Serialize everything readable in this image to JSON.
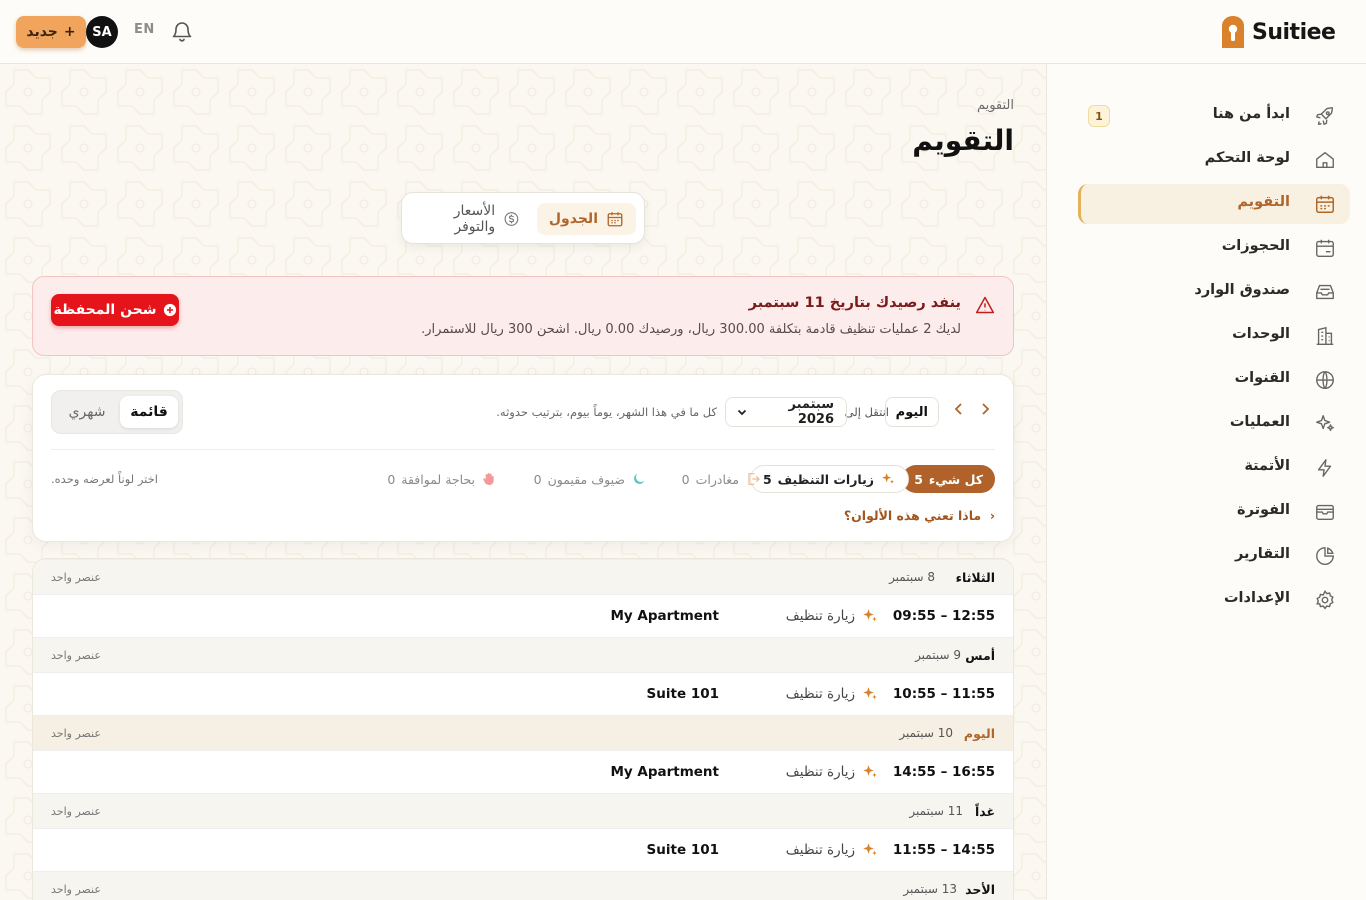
{
  "topbar": {
    "new_label": "جديد",
    "avatar_initials": "SA",
    "lang": "EN",
    "brand": "Suitiee",
    "brand_color": "#d9822b"
  },
  "sidebar": {
    "items": [
      {
        "label": "ابدأ من هنا",
        "icon": "rocket-icon",
        "badge": "1"
      },
      {
        "label": "لوحة التحكم",
        "icon": "home-icon"
      },
      {
        "label": "التقويم",
        "icon": "calendar-icon",
        "active": true
      },
      {
        "label": "الحجوزات",
        "icon": "calendar-booking-icon"
      },
      {
        "label": "صندوق الوارد",
        "icon": "inbox-icon"
      },
      {
        "label": "الوحدات",
        "icon": "building-icon"
      },
      {
        "label": "القنوات",
        "icon": "globe-icon"
      },
      {
        "label": "العمليات",
        "icon": "sparkles-icon"
      },
      {
        "label": "الأتمتة",
        "icon": "lightning-icon"
      },
      {
        "label": "الفوترة",
        "icon": "wallet-icon"
      },
      {
        "label": "التقارير",
        "icon": "pie-chart-icon"
      },
      {
        "label": "الإعدادات",
        "icon": "gear-icon"
      }
    ]
  },
  "page": {
    "breadcrumb": "التقويم",
    "title": "التقويم"
  },
  "tabs": {
    "schedule": "الجدول",
    "pricing": "الأسعار والتوفر"
  },
  "alert": {
    "title": "ينفد رصيدك بتاريخ 11 سبتمبر",
    "text": "لديك 2 عمليات تنظيف قادمة بتكلفة 300.00 ريال، ورصيدك 0.00 ريال. اشحن 300 ريال للاستمرار.",
    "button": "شحن المحفظة"
  },
  "controls": {
    "today": "اليوم",
    "goto": "انتقل إلى",
    "month": "سبتمبر 2026",
    "month_hint": "كل ما في هذا الشهر، يوماً بيوم، بترتيب حدوثه.",
    "view_list": "قائمة",
    "view_month": "شهري"
  },
  "filters": {
    "all": {
      "label": "كل شيء",
      "count": "5"
    },
    "cleaning": {
      "label": "زيارات التنظيف",
      "count": "5"
    },
    "departures": {
      "label": "مغادرات",
      "count": "0"
    },
    "staying": {
      "label": "ضيوف مقيمون",
      "count": "0"
    },
    "approval": {
      "label": "بحاجة لموافقة",
      "count": "0"
    },
    "hint": "اختر لوناً لعرضه وحده.",
    "colors_link": "ماذا تعني هذه الألوان؟"
  },
  "days": [
    {
      "name": "الثلاثاء",
      "date": "8 سبتمبر",
      "count": "عنصر واحد",
      "time": "09:55 – 12:55",
      "type": "زيارة تنظيف",
      "unit": "My Apartment"
    },
    {
      "name": "أمس",
      "date": "9 سبتمبر",
      "count": "عنصر واحد",
      "time": "10:55 – 11:55",
      "type": "زيارة تنظيف",
      "unit": "Suite 101"
    },
    {
      "name": "اليوم",
      "date": "10 سبتمبر",
      "count": "عنصر واحد",
      "time": "14:55 – 16:55",
      "type": "زيارة تنظيف",
      "unit": "My Apartment",
      "today": true
    },
    {
      "name": "غداً",
      "date": "11 سبتمبر",
      "count": "عنصر واحد",
      "time": "11:55 – 14:55",
      "type": "زيارة تنظيف",
      "unit": "Suite 101"
    },
    {
      "name": "الأحد",
      "date": "13 سبتمبر",
      "count": "عنصر واحد"
    }
  ]
}
